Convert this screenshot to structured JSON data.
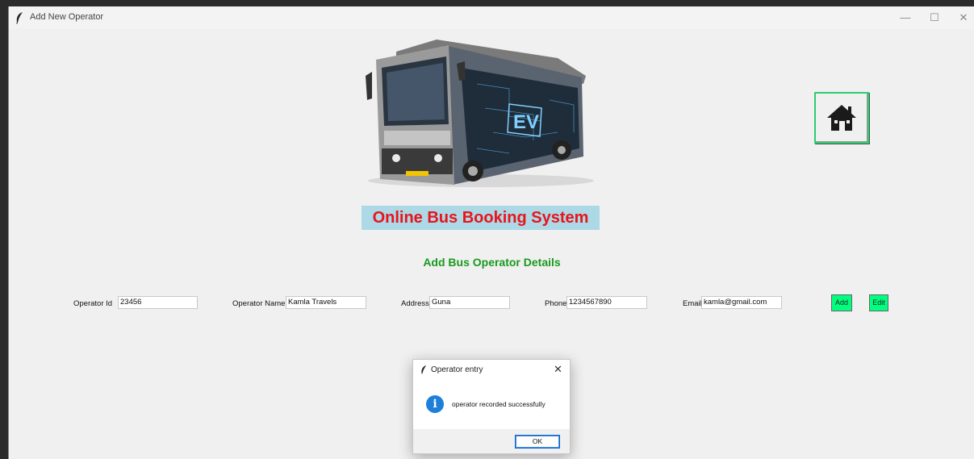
{
  "window": {
    "title": "Add New Operator",
    "minimize_glyph": "—",
    "maximize_glyph": "☐",
    "close_glyph": "✕"
  },
  "main": {
    "app_title": "Online Bus Booking System",
    "section_title": "Add Bus Operator Details",
    "bus_badge_text": "EV",
    "home_icon": "home-icon"
  },
  "form": {
    "fields": [
      {
        "label": "Operator Id",
        "value": "23456"
      },
      {
        "label": "Operator Name",
        "value": "Kamla Travels"
      },
      {
        "label": "Address",
        "value": "Guna"
      },
      {
        "label": "Phone",
        "value": "1234567890"
      },
      {
        "label": "Email",
        "value": "kamla@gmail.com"
      }
    ],
    "add_label": "Add",
    "edit_label": "Edit"
  },
  "dialog": {
    "title": "Operator entry",
    "close_glyph": "✕",
    "icon": "info-icon",
    "message": "operator recorded successfully",
    "ok_label": "OK"
  },
  "colors": {
    "title_text": "#e8141b",
    "title_bg": "#add8e6",
    "section_title": "#189a1f",
    "button_bg": "#00ff7f",
    "info_icon": "#1e7fd8"
  }
}
